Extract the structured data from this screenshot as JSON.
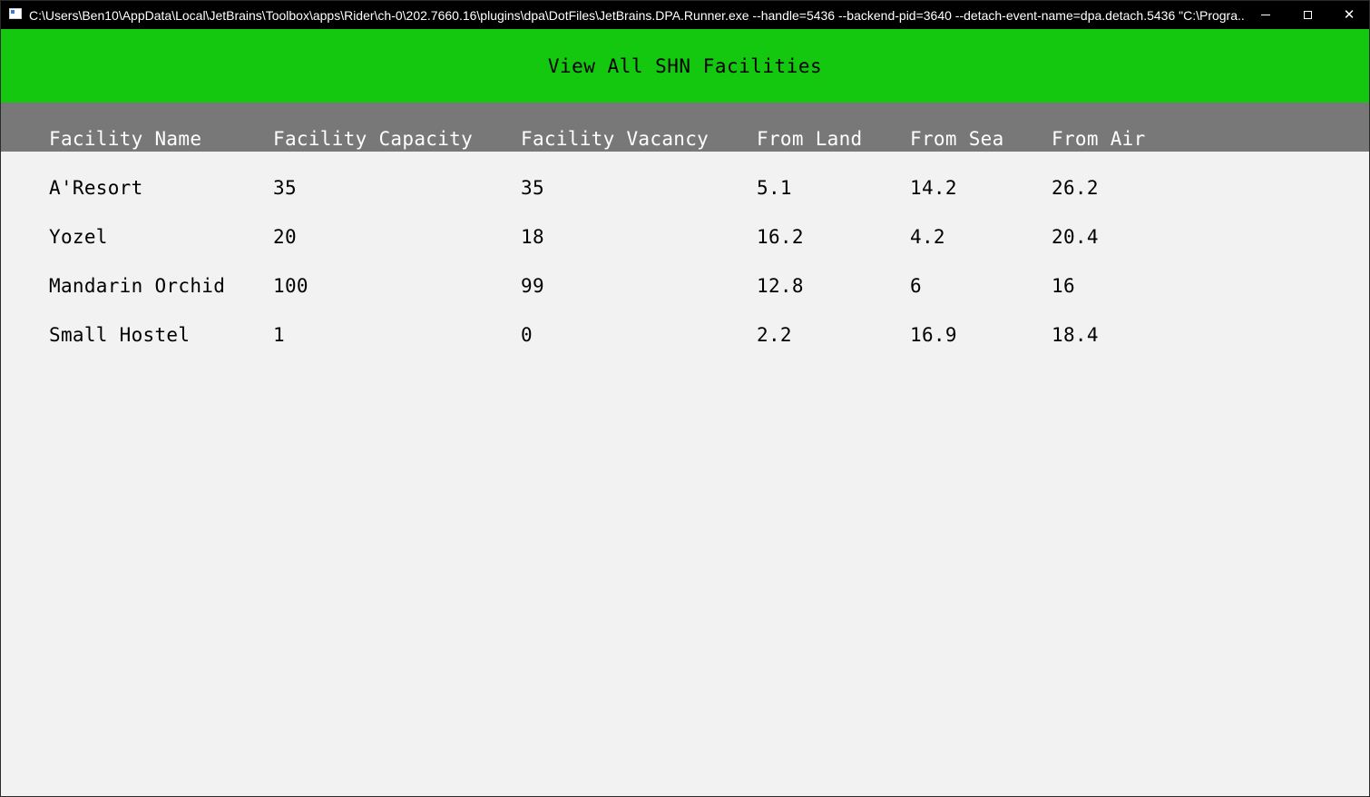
{
  "window": {
    "title": "C:\\Users\\Ben10\\AppData\\Local\\JetBrains\\Toolbox\\apps\\Rider\\ch-0\\202.7660.16\\plugins\\dpa\\DotFiles\\JetBrains.DPA.Runner.exe --handle=5436 --backend-pid=3640 --detach-event-name=dpa.detach.5436 \"C:\\Progra...",
    "controls": {
      "minimize_icon": "minimize-icon",
      "maximize_icon": "maximize-icon",
      "close_glyph": "✕"
    }
  },
  "header": {
    "title": "View All SHN Facilities",
    "background": "#14c80f"
  },
  "table": {
    "header_background": "#787878",
    "columns": [
      "Facility Name",
      "Facility Capacity",
      "Facility Vacancy",
      "From Land",
      "From Sea",
      "From Air"
    ],
    "rows": [
      [
        "A'Resort",
        "35",
        "35",
        "5.1",
        "14.2",
        "26.2"
      ],
      [
        "Yozel",
        "20",
        "18",
        "16.2",
        "4.2",
        "20.4"
      ],
      [
        "Mandarin Orchid",
        "100",
        "99",
        "12.8",
        "6",
        "16"
      ],
      [
        "Small Hostel",
        "1",
        "0",
        "2.2",
        "16.9",
        "18.4"
      ]
    ]
  }
}
